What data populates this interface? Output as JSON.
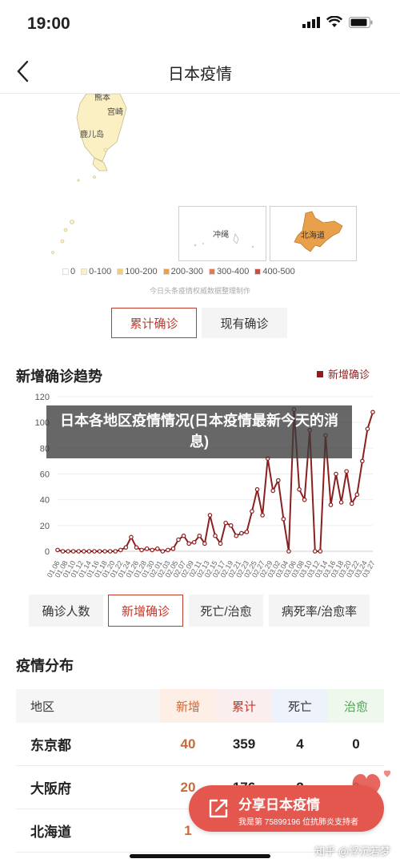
{
  "status_bar": {
    "time": "19:00"
  },
  "nav": {
    "title": "日本疫情"
  },
  "map": {
    "labels": [
      "熊本",
      "宫崎",
      "鹿儿岛"
    ],
    "insets": [
      {
        "label": "冲绳"
      },
      {
        "label": "北海道"
      }
    ],
    "legend": [
      {
        "label": "0",
        "color": "#ffffff"
      },
      {
        "label": "0-100",
        "color": "#fbf0c4"
      },
      {
        "label": "100-200",
        "color": "#f3cc74"
      },
      {
        "label": "200-300",
        "color": "#e9a04b"
      },
      {
        "label": "300-400",
        "color": "#e07a52"
      },
      {
        "label": "400-500",
        "color": "#c9503f"
      }
    ],
    "source": "今日头条疫情权威数据整理制作"
  },
  "view_toggle": {
    "active": "累计确诊",
    "inactive": "现有确诊"
  },
  "trend": {
    "title": "新增确诊趋势",
    "legend_label": "新增确诊"
  },
  "banner": "日本各地区疫情情况(日本疫情最新今天的消息)",
  "chart_data": {
    "type": "line",
    "title": "新增确诊趋势",
    "series": [
      {
        "name": "新增确诊",
        "color": "#8b1f1f",
        "values": [
          1,
          0,
          0,
          0,
          0,
          0,
          0,
          0,
          0,
          0,
          0,
          0,
          1,
          3,
          11,
          3,
          1,
          2,
          1,
          2,
          0,
          1,
          2,
          9,
          12,
          6,
          7,
          12,
          6,
          28,
          12,
          6,
          22,
          20,
          12,
          14,
          15,
          31,
          48,
          28,
          72,
          47,
          55,
          25,
          0,
          110,
          48,
          40,
          94,
          0,
          0,
          90,
          36,
          60,
          38,
          62,
          37,
          44,
          70,
          95,
          108
        ]
      }
    ],
    "x_tick_labels": [
      "01.06",
      "01.08",
      "01.10",
      "01.12",
      "01.14",
      "01.16",
      "01.18",
      "01.20",
      "01.22",
      "01.24",
      "01.26",
      "01.28",
      "01.30",
      "02.01",
      "02.03",
      "02.05",
      "02.07",
      "02.09",
      "02.11",
      "02.13",
      "02.15",
      "02.17",
      "02.19",
      "02.21",
      "02.23",
      "02.25",
      "02.27",
      "02.29",
      "03.02",
      "03.04",
      "03.06",
      "03.08",
      "03.10",
      "03.12",
      "03.14",
      "03.16",
      "03.18",
      "03.20",
      "03.22",
      "03.24",
      "03.27"
    ],
    "y_ticks": [
      0,
      20,
      40,
      60,
      80,
      100,
      120
    ],
    "ylim": [
      0,
      120
    ],
    "grid": true,
    "legend": "top-right"
  },
  "metric_tabs": [
    "确诊人数",
    "新增确诊",
    "死亡/治愈",
    "病死率/治愈率"
  ],
  "metric_tab_active": 1,
  "distribution": {
    "title": "疫情分布",
    "headers": [
      "地区",
      "新增",
      "累计",
      "死亡",
      "治愈"
    ],
    "header_colors": [
      "#f6f6f6",
      "#fdeee6",
      "#fbeeee",
      "#eef2fb",
      "#eef8ec"
    ],
    "header_text_colors": [
      "#333333",
      "#c96a3a",
      "#c0392b",
      "#333333",
      "#49a851"
    ],
    "rows": [
      [
        "东京都",
        "40",
        "359",
        "4",
        "0"
      ],
      [
        "大阪府",
        "20",
        "176",
        "2",
        "0"
      ],
      [
        "北海道",
        "1",
        "",
        "",
        ""
      ]
    ]
  },
  "share": {
    "title": "分享日本疫情",
    "subtitle": "我是第 75899196 位抗肺炎支持者"
  },
  "watermark": "知乎 @浮沉若梦",
  "icons": [
    "back-chevron-icon",
    "signal-icon",
    "wifi-icon",
    "battery-icon",
    "share-icon",
    "heart-icon"
  ]
}
